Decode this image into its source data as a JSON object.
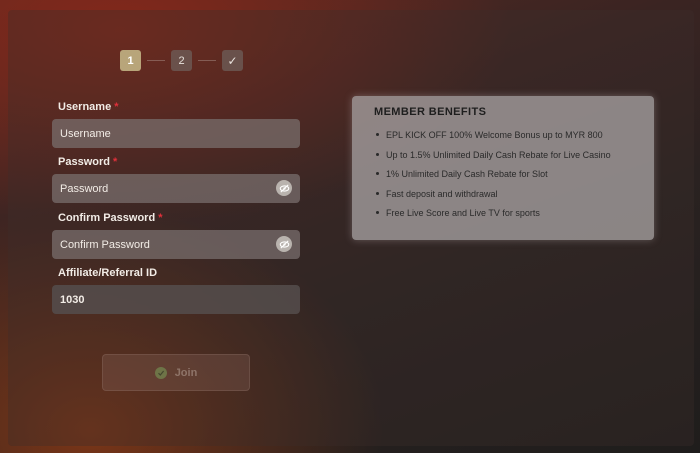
{
  "stepper": {
    "steps": [
      {
        "label": "1",
        "state": "active"
      },
      {
        "label": "2",
        "state": "pending"
      },
      {
        "label": "✓",
        "state": "pending"
      }
    ]
  },
  "form": {
    "username": {
      "label": "Username",
      "required_mark": "*",
      "placeholder": "Username",
      "value": ""
    },
    "password": {
      "label": "Password",
      "required_mark": "*",
      "placeholder": "Password",
      "value": "",
      "toggle_icon": "eye-off-icon"
    },
    "confirm_password": {
      "label": "Confirm Password",
      "required_mark": "*",
      "placeholder": "Confirm Password",
      "value": "",
      "toggle_icon": "eye-off-icon"
    },
    "referral": {
      "label": "Affiliate/Referral ID",
      "placeholder": "",
      "value": "1030"
    }
  },
  "join_button": {
    "label": "Join",
    "icon": "check-circle-icon",
    "enabled": false
  },
  "benefits": {
    "title": "MEMBER BENEFITS",
    "items": [
      "EPL KICK OFF 100% Welcome Bonus up to MYR 800",
      "Up to 1.5% Unlimited Daily Cash Rebate for Live Casino",
      "1% Unlimited Daily Cash Rebate for Slot",
      "Fast deposit and withdrawal",
      "Free Live Score and Live TV for sports"
    ]
  },
  "colors": {
    "accent_step": "#b8a57a",
    "required": "#e0303a"
  }
}
